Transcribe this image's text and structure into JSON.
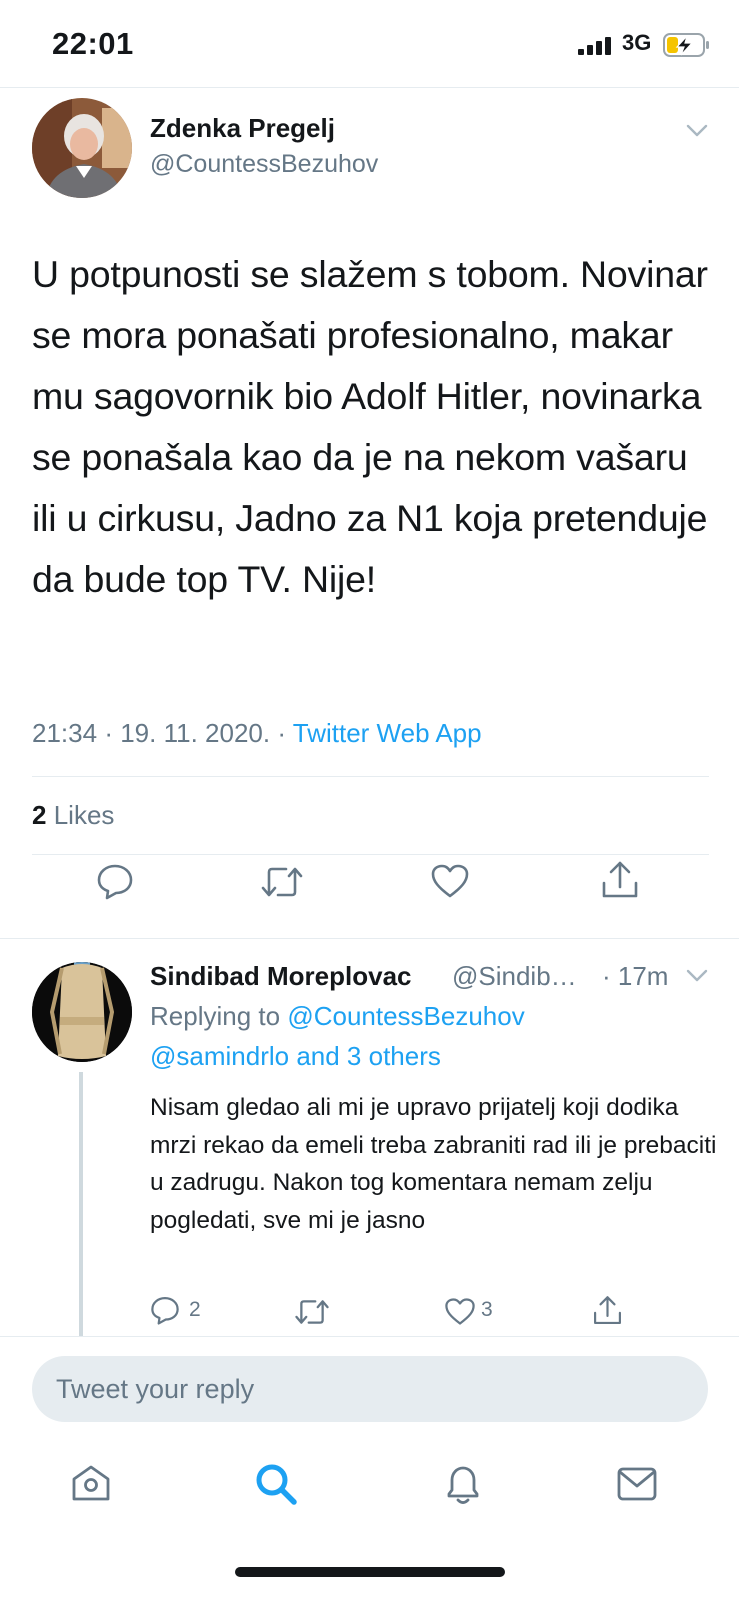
{
  "status_bar": {
    "time": "22:01",
    "network": "3G",
    "icons": [
      "signal-icon",
      "battery-charging-icon"
    ]
  },
  "main_tweet": {
    "author_name": "Zdenka Pregelj",
    "author_handle": "@CountessBezuhov",
    "text": "U potpunosti se slažem s tobom. Novinar se mora ponašati profesionalno, makar mu sagovornik bio Adolf Hitler, novinarka se ponašala kao da je na nekom vašaru ili u cirkusu, Jadno za N1 koja pretenduje da bude top TV. Nije!",
    "time": "21:34",
    "date": "19. 11. 2020.",
    "separator": "·",
    "source": "Twitter Web App",
    "likes_count": "2",
    "likes_label": "Likes",
    "actions": [
      "reply-icon",
      "retweet-icon",
      "like-icon",
      "share-icon"
    ]
  },
  "reply_tweet": {
    "author_name": "Sindibad Moreplovac",
    "author_handle": "@Sindib…",
    "time": "· 17m",
    "replying_prefix": "Replying to",
    "replying_mention": "@CountessBezuhov",
    "replying_others": "@samindrlo and 3 others",
    "text": "Nisam gledao ali mi je upravo prijatelj koji dodika mrzi rekao da emeli treba zabraniti rad ili je prebaciti u zadrugu. Nakon tog komentara nemam zelju pogledati, sve mi je jasno",
    "reply_count": "2",
    "like_count": "3"
  },
  "composer": {
    "placeholder": "Tweet your reply"
  },
  "tab_bar": {
    "tabs": [
      "home-icon",
      "search-icon",
      "notifications-icon",
      "messages-icon"
    ],
    "active": "search-icon"
  },
  "colors": {
    "accent": "#1da1f2",
    "secondary_text": "#657786",
    "divider": "#e6ecf0"
  }
}
